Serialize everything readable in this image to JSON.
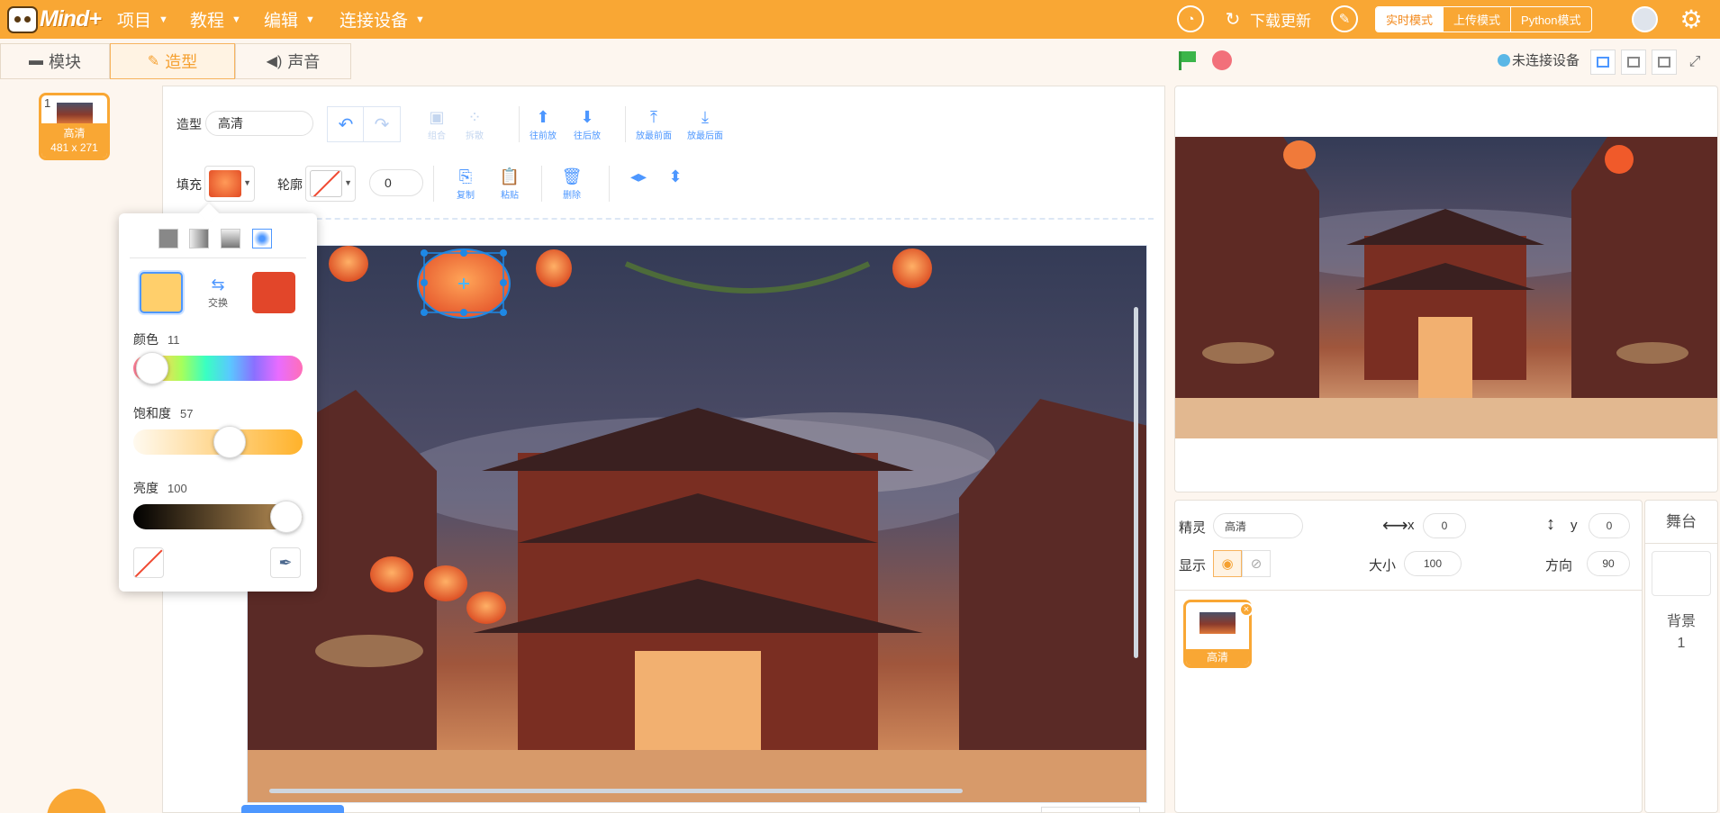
{
  "app": {
    "logo_text": "Mind+"
  },
  "top_menu": [
    {
      "label": "项目"
    },
    {
      "label": "教程"
    },
    {
      "label": "编辑"
    },
    {
      "label": "连接设备"
    }
  ],
  "top_right": {
    "update_label": "下载更新",
    "modes": [
      "实时模式",
      "上传模式",
      "Python模式"
    ],
    "active_mode": "实时模式"
  },
  "tabs": [
    {
      "label": "模块",
      "icon": "blocks-icon"
    },
    {
      "label": "造型",
      "icon": "brush-icon"
    },
    {
      "label": "声音",
      "icon": "speaker-icon"
    }
  ],
  "device_status": "未连接设备",
  "costume_list": [
    {
      "index": "1",
      "name": "高清",
      "size": "481 x 271"
    }
  ],
  "editor": {
    "costume_label": "造型",
    "costume_name": "高清",
    "fill_label": "填充",
    "outline_label": "轮廓",
    "outline_width": "0",
    "tools": {
      "group": "组合",
      "ungroup": "拆散",
      "forward": "往前放",
      "backward": "往后放",
      "front": "放最前面",
      "back": "放最后面",
      "copy": "复制",
      "paste": "粘贴",
      "delete": "删除"
    }
  },
  "color_picker": {
    "swap_label": "交换",
    "hue_label": "颜色",
    "hue_value": "11",
    "saturation_label": "饱和度",
    "saturation_value": "57",
    "brightness_label": "亮度",
    "brightness_value": "100",
    "hue_fraction": 0.11,
    "saturation_fraction": 0.57,
    "brightness_fraction": 1.0,
    "color_a": "#ffcf6b",
    "color_b": "#e2462a"
  },
  "sprite_info": {
    "sprite_label": "精灵",
    "sprite_name": "高清",
    "x_label": "x",
    "x_value": "0",
    "y_label": "y",
    "y_value": "0",
    "show_label": "显示",
    "size_label": "大小",
    "size_value": "100",
    "direction_label": "方向",
    "direction_value": "90"
  },
  "sprites": [
    {
      "name": "高清"
    }
  ],
  "stage_selector": {
    "header": "舞台",
    "backdrop_label": "背景",
    "backdrop_count": "1"
  },
  "colors": {
    "accent": "#f9a734",
    "blue": "#4d97ff"
  }
}
